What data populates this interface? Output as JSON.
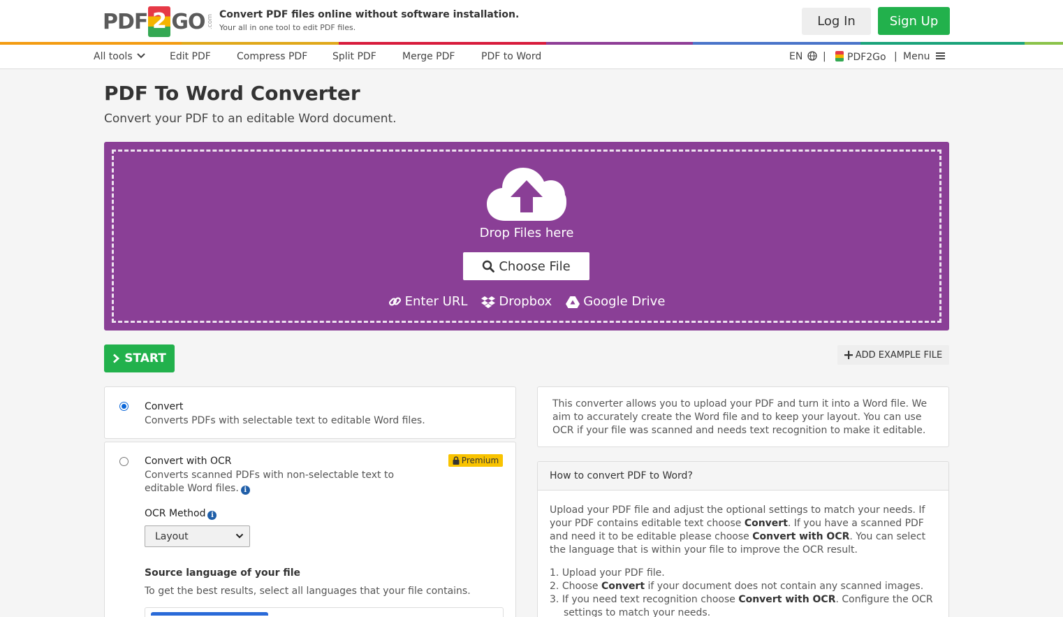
{
  "header": {
    "logo_pdf": "PDF",
    "logo_2": "2",
    "logo_go": "GO",
    "logo_com": ".com",
    "tagline_main": "Convert PDF files online without software installation.",
    "tagline_sub": "Your all in one tool to edit PDF files.",
    "login_label": "Log In",
    "signup_label": "Sign Up"
  },
  "colors": {
    "rainbow": [
      "#f39c12",
      "#e0a81a",
      "#d81b3c",
      "#8e3d96",
      "#4a74c9",
      "#1aa37a",
      "#8bc34a"
    ],
    "accent_purple": "#8a3f96",
    "accent_green": "#22b14c"
  },
  "nav": {
    "all_tools": "All tools",
    "items": [
      "Edit PDF",
      "Compress PDF",
      "Split PDF",
      "Merge PDF",
      "PDF to Word"
    ],
    "lang": "EN",
    "brand": "PDF2Go",
    "menu": "Menu"
  },
  "main": {
    "title": "PDF To Word Converter",
    "subtitle": "Convert your PDF to an editable Word document.",
    "dropzone": {
      "drop_text": "Drop Files here",
      "choose_label": "Choose File",
      "sources": [
        "Enter URL",
        "Dropbox",
        "Google Drive"
      ]
    },
    "start_label": "START",
    "example_label": "ADD EXAMPLE FILE"
  },
  "options": {
    "convert": {
      "title": "Convert",
      "desc": "Converts PDFs with selectable text to editable Word files.",
      "selected": true
    },
    "ocr": {
      "title": "Convert with OCR",
      "desc": "Converts scanned PDFs with non-selectable text to editable Word files.",
      "badge": "Premium",
      "method_label": "OCR Method",
      "method_value": "Layout",
      "lang_title": "Source language of your file",
      "lang_desc": "To get the best results, select all languages that your file contains.",
      "selected": false
    }
  },
  "info": {
    "description": "This converter allows you to upload your PDF and turn it into a Word file. We aim to accurately create the Word file and to keep your layout. You can use OCR if your file was scanned and needs text recognition to make it editable.",
    "howto_title": "How to convert PDF to Word?",
    "howto_p1": "Upload your PDF file and adjust the optional settings to match your needs. If your PDF contains editable text choose",
    "howto_p1_b1": "Convert",
    "howto_p2": ". If you have a scanned PDF and need it to be editable please choose",
    "howto_p2_b2": "Convert with OCR",
    "howto_p3": ". You can select the language that is within your file to improve the OCR result.",
    "steps": [
      {
        "num": "1.",
        "pre": "Upload your PDF file.",
        "bold": "",
        "post": ""
      },
      {
        "num": "2.",
        "pre": "Choose ",
        "bold": "Convert",
        "post": " if your document does not contain any scanned images."
      },
      {
        "num": "3.",
        "pre": "If you need text recognition choose ",
        "bold": "Convert with OCR",
        "post": ". Configure the OCR settings to match your needs."
      }
    ]
  }
}
